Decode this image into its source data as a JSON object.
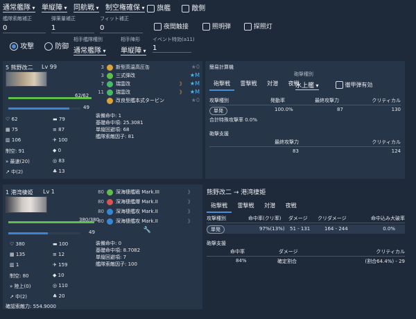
{
  "top_bar": {
    "fleet_type": "通常艦隊",
    "formation": "単縦陣",
    "engagement": "同航戦",
    "air_state": "制空権確保",
    "flagship_label": "旗艦",
    "enemy_label": "敵側"
  },
  "fields": [
    {
      "label": "艦隊索敵補正",
      "value": "0"
    },
    {
      "label": "弾薬量補正",
      "value": "1"
    },
    {
      "label": "フィット補正",
      "value": "0"
    }
  ],
  "options": {
    "night_contact": "夜間触接",
    "flare": "照明弾",
    "searchlight": "探照灯"
  },
  "mode": {
    "attack": "攻撃",
    "defense": "防御"
  },
  "opponent": {
    "fleet_type_label": "相手艦隊種別",
    "fleet_type": "通常艦隊",
    "formation_label": "相手陣形",
    "formation": "単縦陣",
    "event_label": "イベント特効(a11)",
    "event_value": "1"
  },
  "ship": {
    "name": "5 熊野改二",
    "level": "Lv 99",
    "hp": "62/62",
    "bar_value": "49",
    "equipment": [
      {
        "slot": "3",
        "name": "新型高温高圧缶",
        "star": "★0",
        "prof": ""
      },
      {
        "slot": "3",
        "name": "三式弾改",
        "star": "★M",
        "prof": ""
      },
      {
        "slot": "7",
        "name": "瑞雲改",
        "star": "★M",
        "prof": "lv"
      },
      {
        "slot": "11",
        "name": "瑞雲改",
        "star": "★M",
        "prof": "lv"
      },
      {
        "slot": "",
        "name": "改良型艦本式タービン",
        "star": "★0",
        "prof": ""
      }
    ],
    "details": [
      "装備命中: 1",
      "基礎命中項: 25.3081",
      "単縦回避項: 68",
      "艦隊索敵因子: 81"
    ],
    "stats": [
      [
        "62",
        "79"
      ],
      [
        "75",
        "87"
      ],
      [
        "106",
        "100"
      ],
      [
        "制空: 91",
        "0"
      ],
      [
        "最速(20)",
        "83"
      ],
      [
        "中(2)",
        "13"
      ]
    ]
  },
  "calc": {
    "title": "簡易計算機",
    "tabs": [
      "砲撃戦",
      "雷撃戦",
      "対潜",
      "夜戦"
    ],
    "type_label": "砲撃種別",
    "type_value": "水上艦",
    "armor_label": "徹甲弾有効",
    "headers": [
      "攻撃種別",
      "発動率",
      "最終攻撃力",
      "クリティカル"
    ],
    "row": [
      "単発",
      "100.0%",
      "87",
      "130"
    ],
    "special_rate": "合計特殊攻撃率 0.0%",
    "support_title": "砲撃支援",
    "support_headers": [
      "最終攻撃力",
      "クリティカル"
    ],
    "support_row": [
      "83",
      "124"
    ]
  },
  "enemy": {
    "name": "1 港湾棲姫",
    "level": "Lv 1",
    "hp": "380/380",
    "bar_value": "49",
    "equipment": [
      {
        "slot": "80",
        "name": "深海棲艦戦 Mark.III"
      },
      {
        "slot": "80",
        "name": "深海棲艦爆 Mark.II"
      },
      {
        "slot": "80",
        "name": "深海棲艦攻 Mark.II"
      },
      {
        "slot": "80",
        "name": "深海棲艦攻 Mark.II"
      }
    ],
    "details": [
      "装備命中: 0",
      "基礎命中項: 8.7082",
      "単縦回避項: 7",
      "艦隊索敵因子: 100"
    ],
    "stats": [
      [
        "380",
        "100"
      ],
      [
        "135",
        "12"
      ],
      [
        "1",
        "159"
      ],
      [
        "制空: 80",
        "10"
      ],
      [
        "陸上(0)",
        "110"
      ],
      [
        "中(2)",
        "20"
      ]
    ],
    "footer": "確認索敵力: 554.9000"
  },
  "battle": {
    "title": "熊野改二 → 港湾棲姫",
    "tabs": [
      "砲撃戦",
      "雷撃戦",
      "対潜",
      "夜戦"
    ],
    "headers": [
      "攻撃種別",
      "命中率(クリ率)",
      "ダメージ",
      "クリダメージ",
      "命中込み大破率"
    ],
    "row": [
      "単発",
      "97%(13%)",
      "51 - 131",
      "164 - 244",
      "0.0%"
    ],
    "support_title": "砲撃支援",
    "support_headers": [
      "命中率",
      "ダメージ",
      "クリティカル"
    ],
    "support_row": [
      "84%",
      "確定割合",
      "(割合64.4%) - 29"
    ]
  },
  "colors": {
    "background": "#1e2a3a",
    "panel": "#273548",
    "accent": "#4a90d9",
    "hp_bar": "#5fbf4a",
    "blue_bar": "#3a86d6",
    "star": "#4db8ff"
  }
}
